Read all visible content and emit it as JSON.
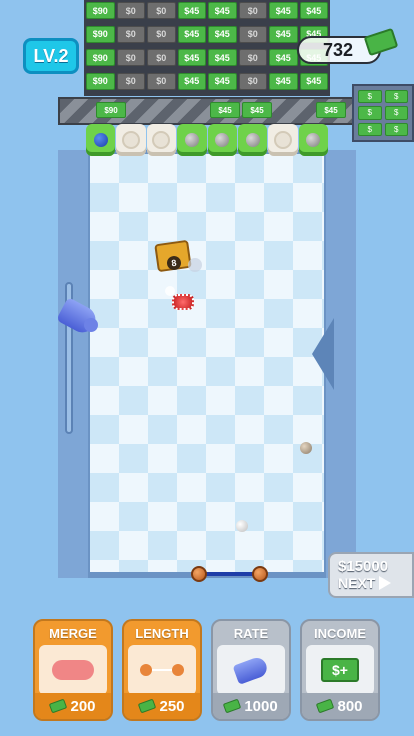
{
  "hud": {
    "level": "LV.2",
    "cash": "732"
  },
  "money_wall": [
    "$90",
    "$0",
    "$0",
    "$45",
    "$45",
    "$0",
    "$45",
    "$45",
    "$90",
    "$0",
    "$0",
    "$45",
    "$45",
    "$0",
    "$45",
    "$45",
    "$90",
    "$0",
    "$0",
    "$45",
    "$45",
    "$0",
    "$45",
    "$45",
    "$90",
    "$0",
    "$0",
    "$45",
    "$45",
    "$0",
    "$45",
    "$45"
  ],
  "conveyor_bills": [
    "$90",
    "$45",
    "$45",
    "$45"
  ],
  "stack_bills": [
    "$",
    "$",
    "$",
    "$",
    "$",
    "$"
  ],
  "chest_value": "8",
  "next": {
    "price": "$15000",
    "label": "NEXT"
  },
  "upgrades": [
    {
      "title": "MERGE",
      "cost": "200"
    },
    {
      "title": "LENGTH",
      "cost": "250"
    },
    {
      "title": "RATE",
      "cost": "1000"
    },
    {
      "title": "INCOME",
      "cost": "800"
    }
  ],
  "colors": {
    "accent_orange": "#f29a2e",
    "disabled_gray": "#b8c0ca",
    "money_green": "#4cb848",
    "level_cyan": "#1fc7e8"
  }
}
